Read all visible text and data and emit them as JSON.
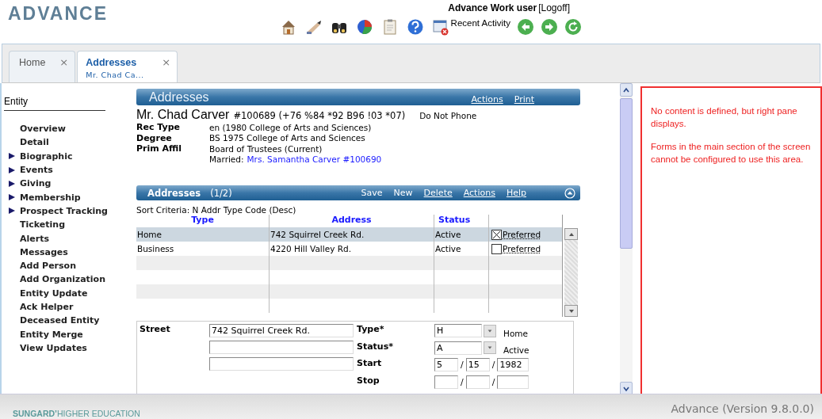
{
  "header": {
    "logo": "ADVANCE",
    "user": "Advance Work user",
    "logoff": "[Logoff]",
    "recent_activity": "Recent Activity"
  },
  "tabs": [
    {
      "label": "Home",
      "close": "×",
      "selected": false
    },
    {
      "label": "Addresses",
      "subtitle": "Mr. Chad Ca...",
      "close": "×",
      "selected": true
    }
  ],
  "sidebar": {
    "title": "Entity",
    "items": [
      {
        "label": "Overview",
        "expandable": false
      },
      {
        "label": "Detail",
        "expandable": false
      },
      {
        "label": "Biographic",
        "expandable": true
      },
      {
        "label": "Events",
        "expandable": true
      },
      {
        "label": "Giving",
        "expandable": true
      },
      {
        "label": "Membership",
        "expandable": true
      },
      {
        "label": "Prospect Tracking",
        "expandable": true
      },
      {
        "label": "Ticketing",
        "expandable": false
      },
      {
        "label": "Alerts",
        "expandable": false
      },
      {
        "label": "Messages",
        "expandable": false
      },
      {
        "label": "Add Person",
        "expandable": false
      },
      {
        "label": "Add Organization",
        "expandable": false
      },
      {
        "label": "Entity Update",
        "expandable": false
      },
      {
        "label": "Ack Helper",
        "expandable": false
      },
      {
        "label": "Deceased Entity",
        "expandable": false
      },
      {
        "label": "Entity Merge",
        "expandable": false
      },
      {
        "label": "View Updates",
        "expandable": false
      }
    ]
  },
  "page_panel": {
    "title": "Addresses",
    "actions": [
      "Actions",
      "Print"
    ]
  },
  "person": {
    "name": "Mr. Chad Carver",
    "id": "#100689 (+76 %84 *92 B96 !03 *07)",
    "flag": "Do Not Phone",
    "fields": [
      {
        "label": "Rec Type",
        "value": "en (1980 College of Arts and Sciences)"
      },
      {
        "label": "Degree",
        "value": "BS 1975 College of Arts and Sciences"
      },
      {
        "label": "Prim Affil",
        "value": "Board of Trustees (Current)"
      }
    ],
    "married_label": "Married:",
    "married_link": "Mrs. Samantha Carver #100690"
  },
  "addresses": {
    "title": "Addresses",
    "count": "(1/2)",
    "actions": [
      "Save",
      "New",
      "Delete",
      "Actions",
      "Help"
    ],
    "sort": "Sort Criteria: N Addr Type Code (Desc)",
    "columns": [
      "Type",
      "Address",
      "Status"
    ],
    "rows": [
      {
        "type": "Home",
        "address": "742 Squirrel Creek Rd.",
        "status": "Active",
        "preferred": true,
        "preferred_label": "Preferred",
        "selected": true
      },
      {
        "type": "Business",
        "address": "4220 Hill Valley Rd.",
        "status": "Active",
        "preferred": false,
        "preferred_label": "Preferred",
        "selected": false
      }
    ]
  },
  "form": {
    "street_label": "Street",
    "street_lines": [
      "742 Squirrel Creek Rd."
    ],
    "type": {
      "label": "Type*",
      "value": "H",
      "description": "Home"
    },
    "status": {
      "label": "Status*",
      "value": "A",
      "description": "Active"
    },
    "start": {
      "label": "Start",
      "parts": [
        "5",
        "15",
        "1982"
      ]
    },
    "stop": {
      "label": "Stop"
    },
    "separator": "/"
  },
  "right_pane": {
    "paragraphs": [
      "No content is defined, but right pane displays.",
      "Forms in the main section of the screen cannot be configured to use this area."
    ]
  },
  "footer": {
    "brand": "**SUNGARD’**HIGHER EDUCATION",
    "version": "Advance (Version 9.8.0.0)"
  }
}
